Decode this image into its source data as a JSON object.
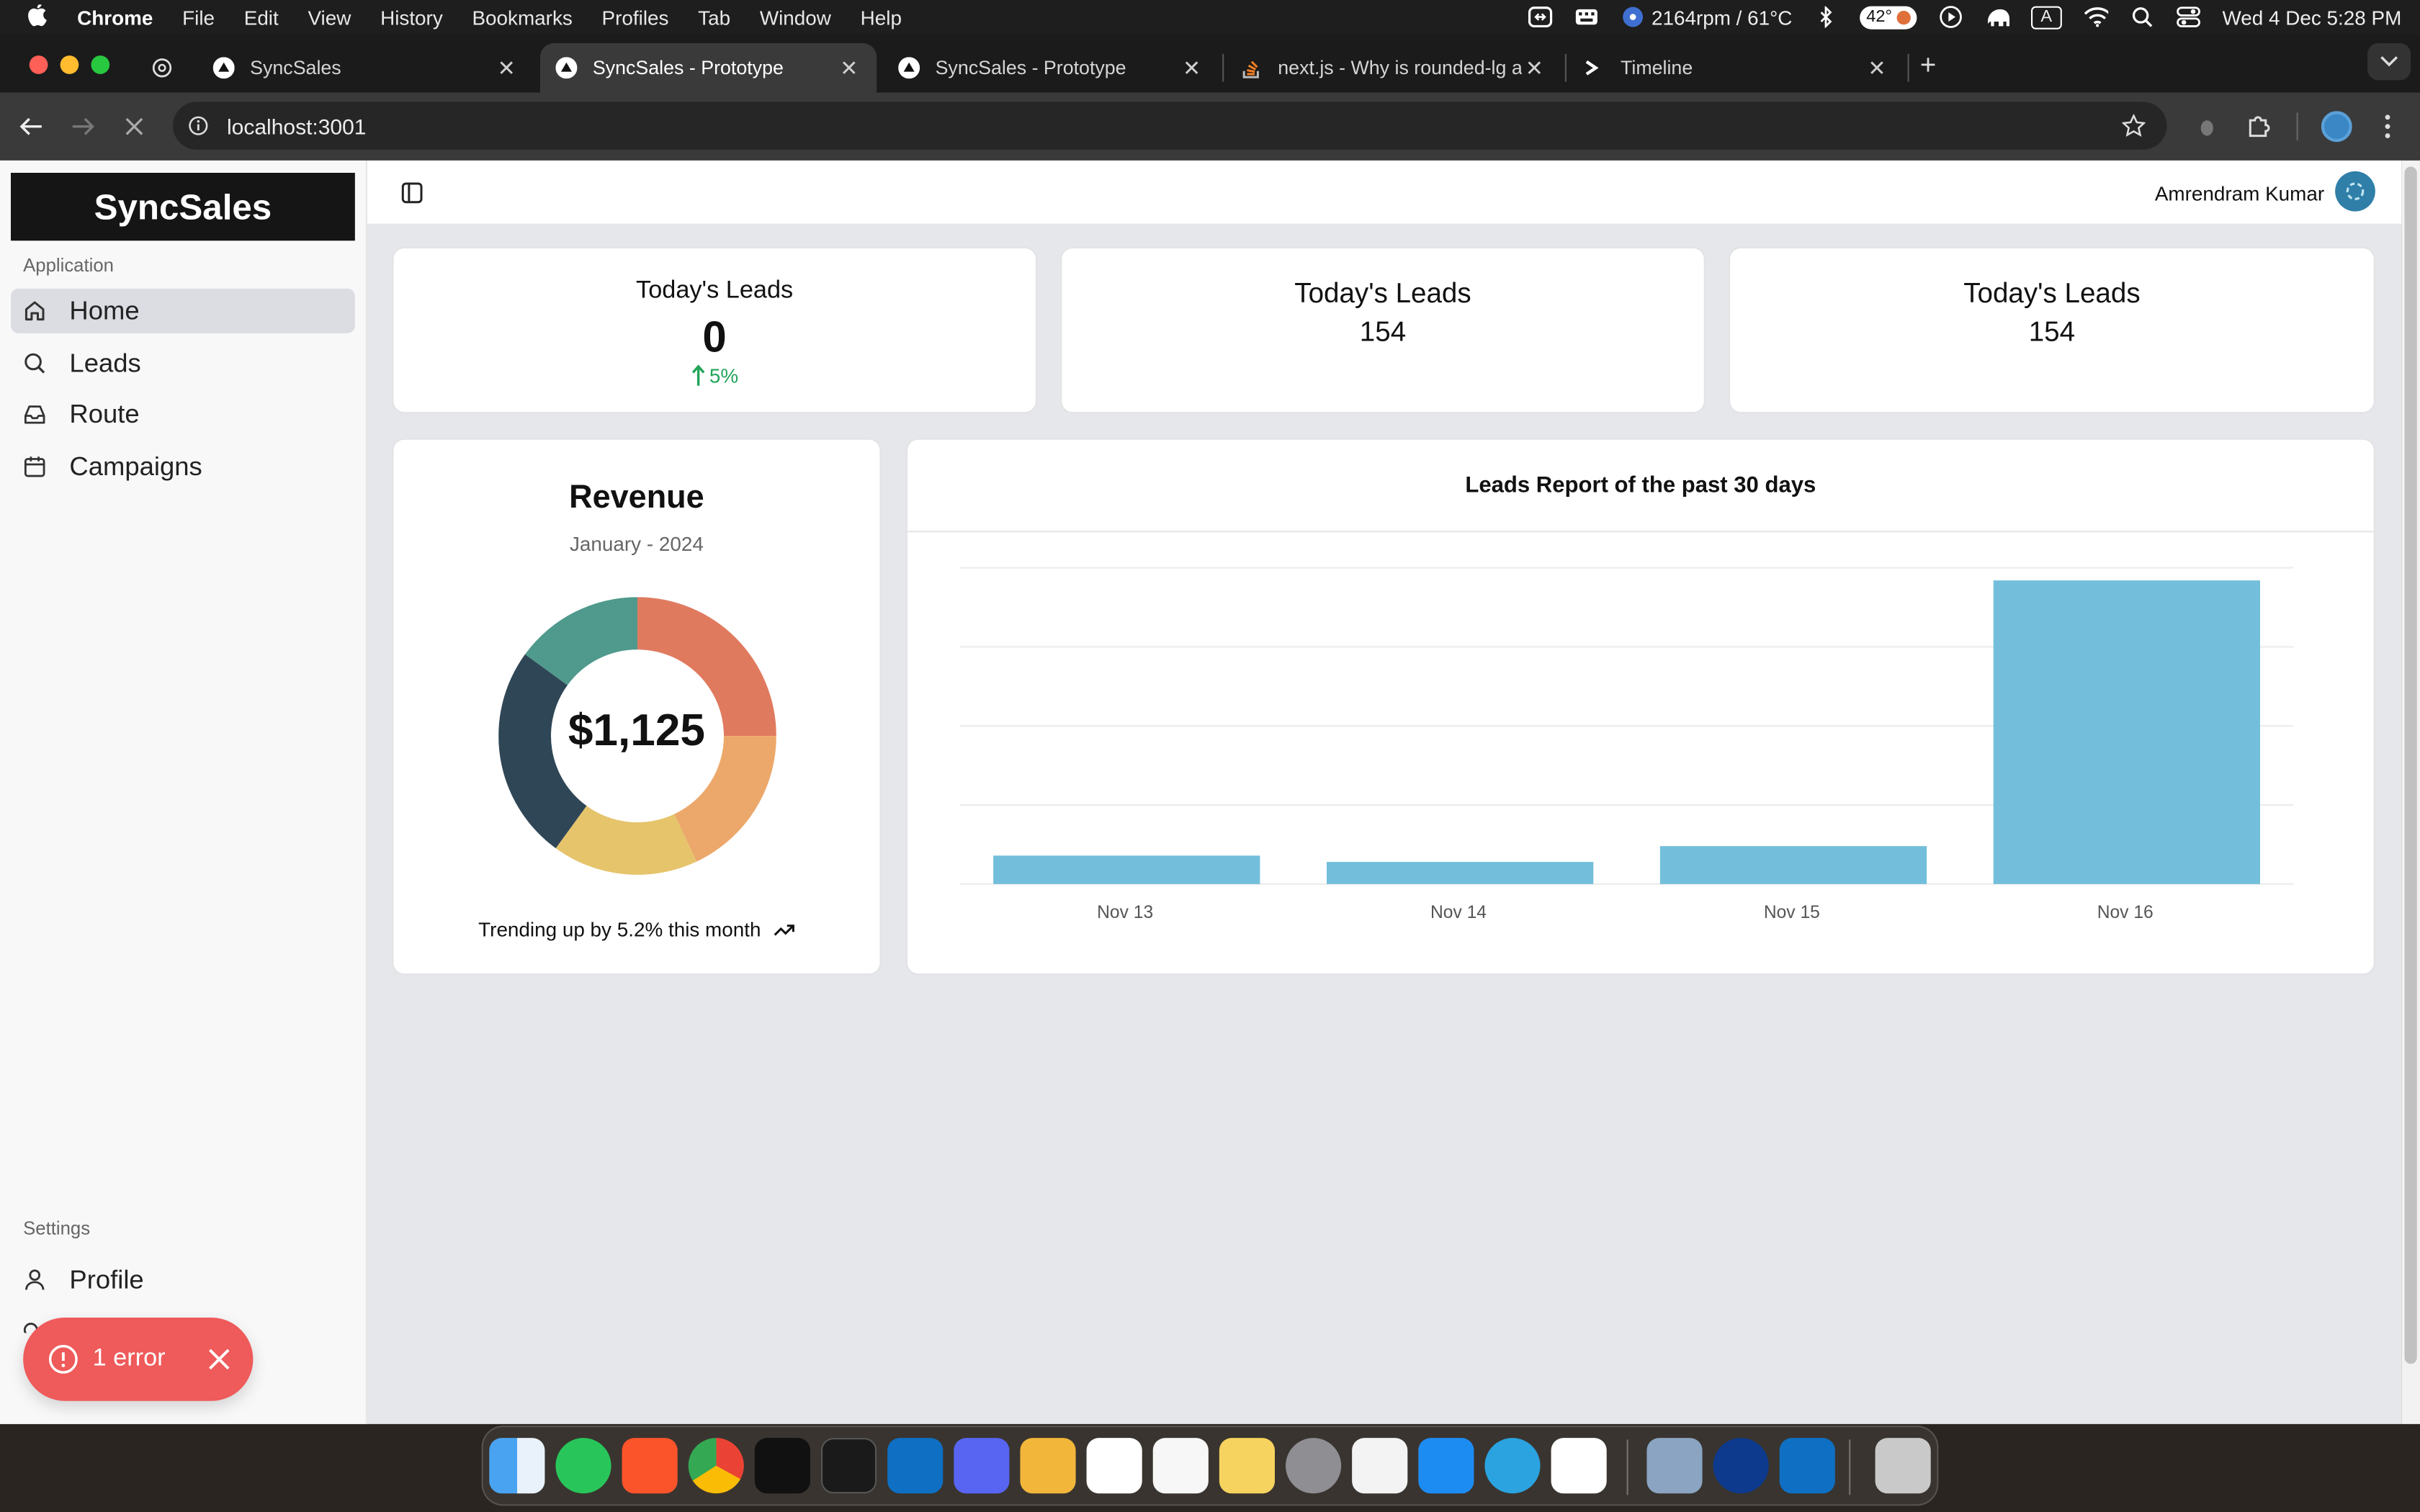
{
  "menubar": {
    "app": "Chrome",
    "items": [
      "File",
      "Edit",
      "View",
      "History",
      "Bookmarks",
      "Profiles",
      "Tab",
      "Window",
      "Help"
    ],
    "fan": "2164rpm / 61°C",
    "temp": "42°",
    "keyboard": "A",
    "clock": "Wed 4 Dec  5:28 PM"
  },
  "tabs": [
    {
      "title": "",
      "icon": "chatgpt-icon"
    },
    {
      "title": "SyncSales",
      "icon": "vercel-icon"
    },
    {
      "title": "SyncSales - Prototype",
      "icon": "vercel-icon",
      "active": true
    },
    {
      "title": "SyncSales - Prototype",
      "icon": "vercel-icon"
    },
    {
      "title": "next.js - Why is rounded-lg a",
      "icon": "stackoverflow-icon"
    },
    {
      "title": "Timeline",
      "icon": "terminal-icon"
    }
  ],
  "url": "localhost:3001",
  "sidebar": {
    "brand": "SyncSales",
    "group1": "Application",
    "items": [
      {
        "label": "Home",
        "icon": "home-icon"
      },
      {
        "label": "Leads",
        "icon": "search-icon"
      },
      {
        "label": "Route",
        "icon": "inbox-icon"
      },
      {
        "label": "Campaigns",
        "icon": "calendar-icon"
      }
    ],
    "group2": "Settings",
    "profile": "Profile"
  },
  "header": {
    "user": "Amrendram Kumar"
  },
  "stats": [
    {
      "title": "Today's Leads",
      "value": "0",
      "delta": "5%"
    },
    {
      "title": "Today's Leads",
      "value": "154"
    },
    {
      "title": "Today's Leads",
      "value": "154"
    }
  ],
  "revenue": {
    "title": "Revenue",
    "period": "January - 2024",
    "total": "$1,125",
    "footer": "Trending up by 5.2% this month"
  },
  "report": {
    "title": "Leads Report of the past 30 days"
  },
  "error": {
    "label": "1 error"
  },
  "colors": {
    "bar": "#73bfdb",
    "donut": [
      "#e07a5f",
      "#eca86b",
      "#e6c46b",
      "#2f4656",
      "#4f9a8c"
    ],
    "error": "#ef5a5a",
    "success": "#22a55a"
  },
  "chart_data": [
    {
      "type": "pie",
      "categories": [
        "",
        "",
        "",
        "",
        ""
      ],
      "values": [
        25,
        18,
        17,
        25,
        15
      ]
    },
    {
      "type": "bar",
      "categories": [
        "Nov 13",
        "Nov 14",
        "Nov 15",
        "Nov 16"
      ],
      "values": [
        9,
        7,
        12,
        96
      ],
      "ylim": [
        0,
        100
      ],
      "grid": true
    }
  ]
}
